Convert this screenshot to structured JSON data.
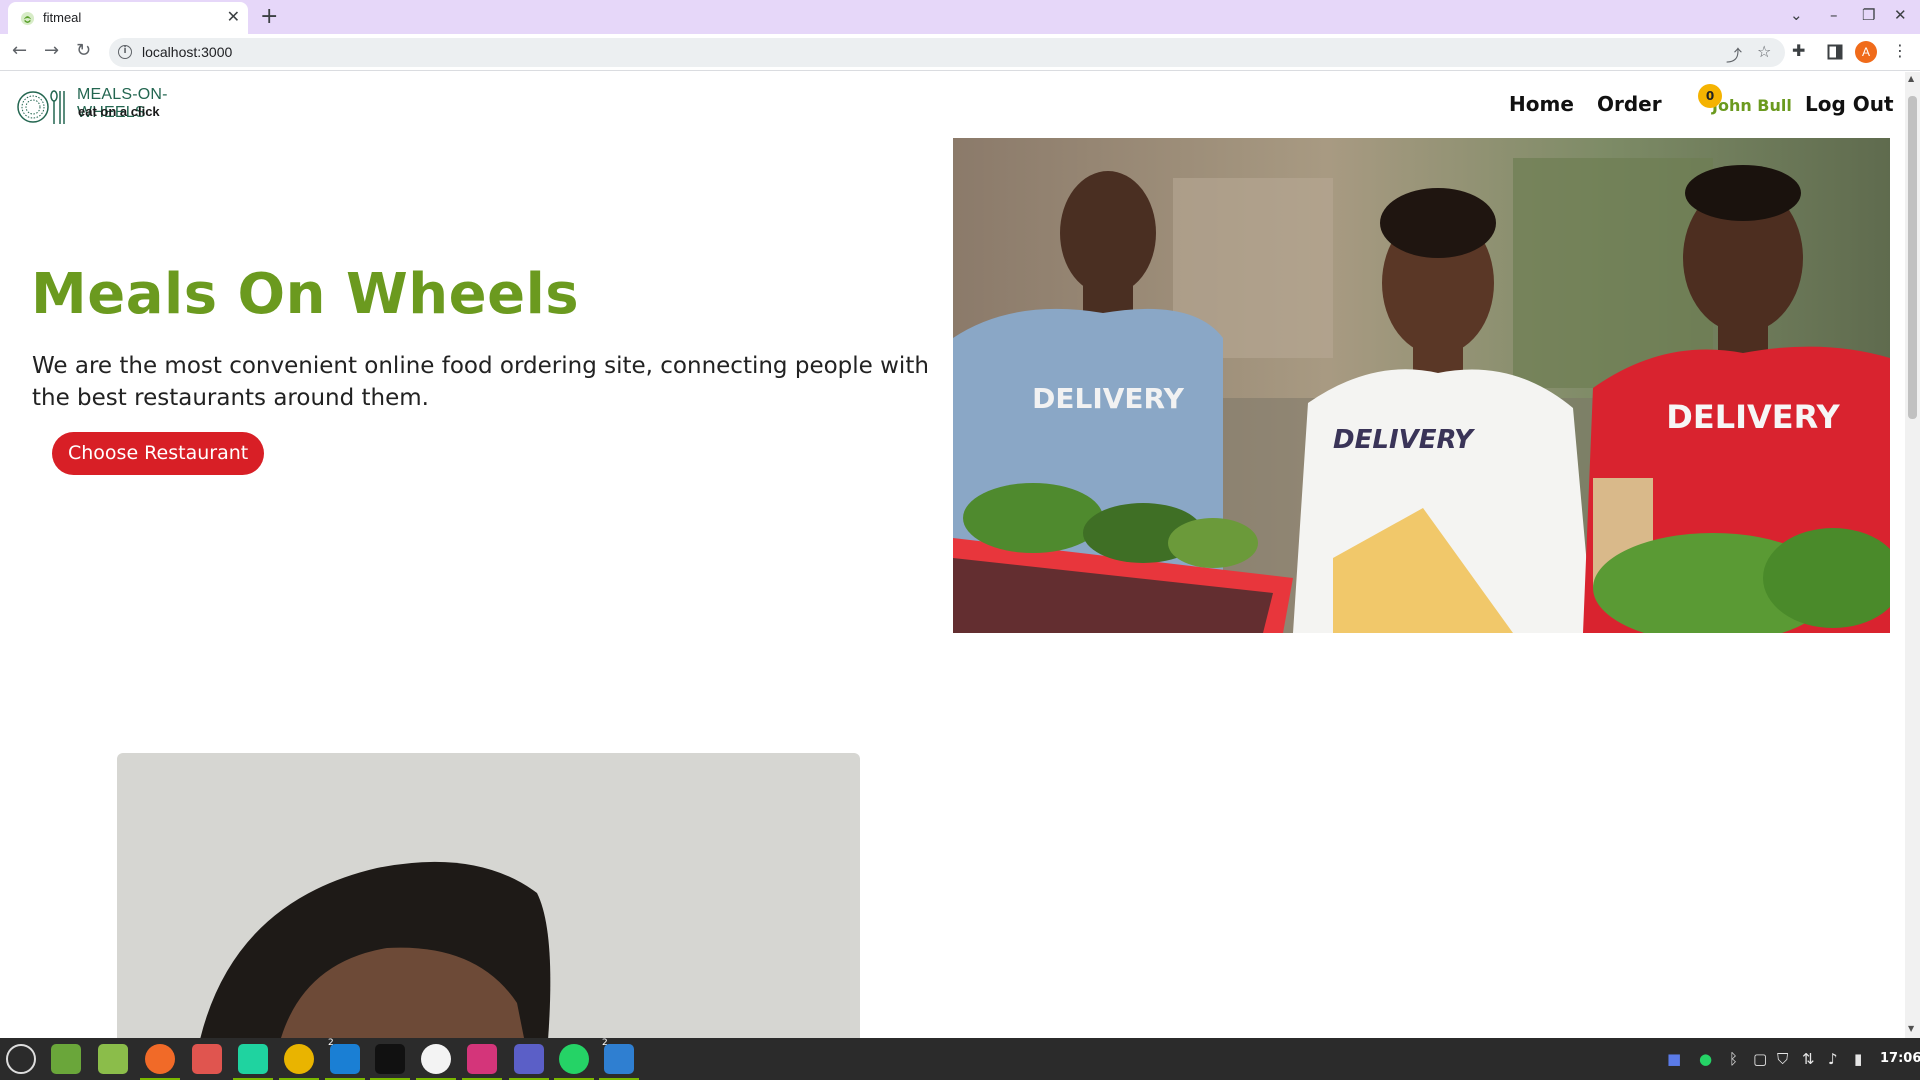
{
  "browser": {
    "tab_title": "fitmeal",
    "tab_close": "✕",
    "new_tab": "+",
    "url": "localhost:3000",
    "profile_initial": "A",
    "controls": {
      "dropdown": "⌄",
      "minimize": "–",
      "restore": "❐",
      "close": "✕"
    },
    "icons": [
      "back-arrow-icon",
      "forward-arrow-icon",
      "reload-icon",
      "site-info-icon",
      "share-icon",
      "bookmark-star-icon",
      "extensions-puzzle-icon",
      "side-panel-icon",
      "menu-kebab-icon"
    ]
  },
  "navbar": {
    "logo_name": "MEALS-ON-WHEELS",
    "logo_tagline": "eat on a click",
    "links": {
      "home": "Home",
      "order": "Order",
      "logout": "Log Out"
    },
    "cart_count": "0",
    "user_name": "John Bull"
  },
  "hero": {
    "title": "Meals On Wheels",
    "description": "We are the most convenient online food ordering site, connecting people with the best restaurants around them.",
    "cta_label": "Choose Restaurant",
    "image_shirt_text": [
      "DELIVERY",
      "DELIVERY",
      "DELIVERY"
    ]
  },
  "colors": {
    "brand_green": "#6b9a1f",
    "cta_red": "#d81f26",
    "badge_yellow": "#f5b301",
    "tab_bar": "#e6d7f9"
  },
  "taskbar": {
    "apps": [
      "mint-menu-icon",
      "show-desktop-icon",
      "files-icon",
      "firefox-icon",
      "readers-icon",
      "pycharm-icon",
      "chrome-icon",
      "vscode-icon",
      "terminal-icon",
      "app-icon",
      "intellij-icon",
      "teams-icon",
      "whatsapp-icon",
      "text-editor-icon"
    ],
    "badges": {
      "vscode": "2",
      "text_editor": "2"
    },
    "clock": "17:06"
  }
}
